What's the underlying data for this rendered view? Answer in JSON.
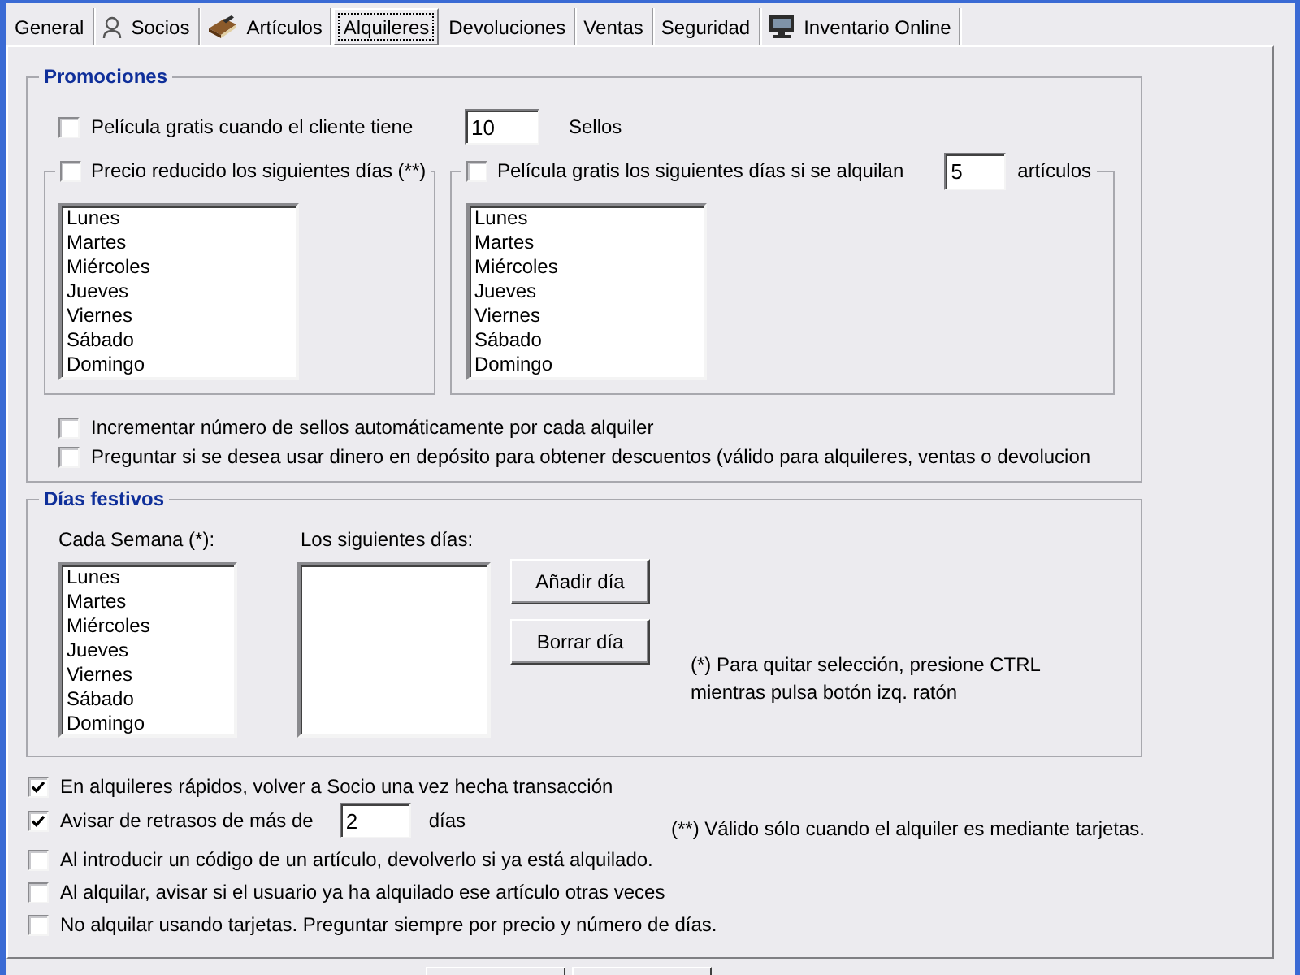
{
  "tabs": [
    {
      "label": "General",
      "kind": "plain",
      "selected": false
    },
    {
      "label": "Socios",
      "kind": "bust",
      "selected": false
    },
    {
      "label": "Artículos",
      "kind": "book",
      "selected": false
    },
    {
      "label": "Alquileres",
      "kind": "plain",
      "selected": true
    },
    {
      "label": "Devoluciones",
      "kind": "plain",
      "selected": false
    },
    {
      "label": "Ventas",
      "kind": "plain",
      "selected": false
    },
    {
      "label": "Seguridad",
      "kind": "plain",
      "selected": false
    },
    {
      "label": "Inventario Online",
      "kind": "monitor",
      "selected": false
    }
  ],
  "promotions": {
    "title": "Promociones",
    "free_by_stamps": {
      "checked": false,
      "label": "Película gratis cuando el cliente tiene",
      "value": "10",
      "unit": "Sellos"
    },
    "reduced_price": {
      "checked": false,
      "label": "Precio reducido los siguientes días (**)",
      "days": [
        {
          "label": "Lunes",
          "selected": false
        },
        {
          "label": "Martes",
          "selected": false
        },
        {
          "label": "Miércoles",
          "selected": false
        },
        {
          "label": "Jueves",
          "selected": false
        },
        {
          "label": "Viernes",
          "selected": false
        },
        {
          "label": "Sábado",
          "selected": false
        },
        {
          "label": "Domingo",
          "selected": false
        }
      ]
    },
    "free_by_items": {
      "checked": false,
      "label": "Película gratis los siguientes días si se alquilan",
      "value": "5",
      "unit": "artículos",
      "days": [
        {
          "label": "Lunes",
          "selected": false
        },
        {
          "label": "Martes",
          "selected": false
        },
        {
          "label": "Miércoles",
          "selected": false
        },
        {
          "label": "Jueves",
          "selected": false
        },
        {
          "label": "Viernes",
          "selected": false
        },
        {
          "label": "Sábado",
          "selected": false
        },
        {
          "label": "Domingo",
          "selected": false
        }
      ]
    },
    "options": [
      {
        "checked": false,
        "label": "Incrementar número de sellos automáticamente por cada alquiler"
      },
      {
        "checked": false,
        "label": "Preguntar si se desea usar dinero en depósito para obtener descuentos (válido para alquileres, ventas o devolucion"
      }
    ]
  },
  "holidays": {
    "title": "Días festivos",
    "weekly": {
      "label": "Cada Semana (*):",
      "days": [
        {
          "label": "Lunes",
          "selected": false
        },
        {
          "label": "Martes",
          "selected": false
        },
        {
          "label": "Miércoles",
          "selected": false
        },
        {
          "label": "Jueves",
          "selected": false
        },
        {
          "label": "Viernes",
          "selected": false
        },
        {
          "label": "Sábado",
          "selected": false
        },
        {
          "label": "Domingo",
          "selected": false
        }
      ]
    },
    "specific": {
      "label": "Los siguientes días:"
    },
    "buttons": [
      {
        "label": "Añadir día"
      },
      {
        "label": "Borrar día"
      }
    ],
    "note": "(*) Para quitar selección, presione CTRL mientras pulsa botón izq. ratón"
  },
  "options": [
    {
      "kind": "check",
      "checked": true,
      "label": "En alquileres rápidos, volver a Socio una vez hecha transacción"
    },
    {
      "kind": "days",
      "checked": true,
      "label": "Avisar de retrasos de más de",
      "value": "2",
      "unit": "días"
    },
    {
      "kind": "check",
      "checked": false,
      "label": "Al introducir un código de un artículo, devolverlo si ya está alquilado."
    },
    {
      "kind": "check",
      "checked": false,
      "label": "Al alquilar, avisar si el usuario ya ha alquilado ese artículo otras veces"
    },
    {
      "kind": "check",
      "checked": false,
      "label": "No alquilar usando tarjetas. Preguntar siempre por precio y número de días."
    }
  ],
  "footnote": "(**) Válido sólo cuando el alquiler es mediante tarjetas."
}
